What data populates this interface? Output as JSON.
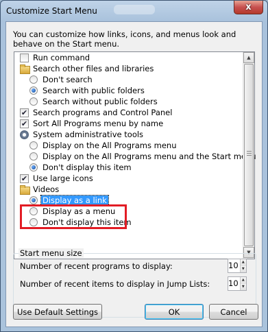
{
  "window": {
    "title": "Customize Start Menu",
    "close_glyph": "x"
  },
  "description": "You can customize how links, icons, and menus look and behave on the Start menu.",
  "list": {
    "rows": [
      {
        "type": "checkbox",
        "label": "Run command",
        "checked": false
      },
      {
        "type": "folder",
        "label": "Search other files and libraries"
      },
      {
        "type": "radio",
        "label": "Don't search",
        "selected": false
      },
      {
        "type": "radio",
        "label": "Search with public folders",
        "selected": true
      },
      {
        "type": "radio",
        "label": "Search without public folders",
        "selected": false
      },
      {
        "type": "checkbox",
        "label": "Search programs and Control Panel",
        "checked": true
      },
      {
        "type": "checkbox",
        "label": "Sort All Programs menu by name",
        "checked": true
      },
      {
        "type": "gear",
        "label": "System administrative tools"
      },
      {
        "type": "radio",
        "label": "Display on the All Programs menu",
        "selected": false
      },
      {
        "type": "radio",
        "label": "Display on the All Programs menu and the Start menu",
        "selected": false
      },
      {
        "type": "radio",
        "label": "Don't display this item",
        "selected": true
      },
      {
        "type": "checkbox",
        "label": "Use large icons",
        "checked": true
      },
      {
        "type": "folder",
        "label": "Videos"
      },
      {
        "type": "radio",
        "label": "Display as a link",
        "selected": true,
        "focused": true
      },
      {
        "type": "radio",
        "label": "Display as a menu",
        "selected": false
      },
      {
        "type": "radio",
        "label": "Don't display this item",
        "selected": false
      }
    ]
  },
  "size_group": {
    "legend": "Start menu size",
    "recent_programs_label": "Number of recent programs to display:",
    "recent_programs_value": "10",
    "recent_items_label": "Number of recent items to display in Jump Lists:",
    "recent_items_value": "10"
  },
  "buttons": {
    "defaults": "Use Default Settings",
    "ok": "OK",
    "cancel": "Cancel"
  },
  "colors": {
    "highlight_box": "#e21c24",
    "selection": "#3399ff"
  }
}
